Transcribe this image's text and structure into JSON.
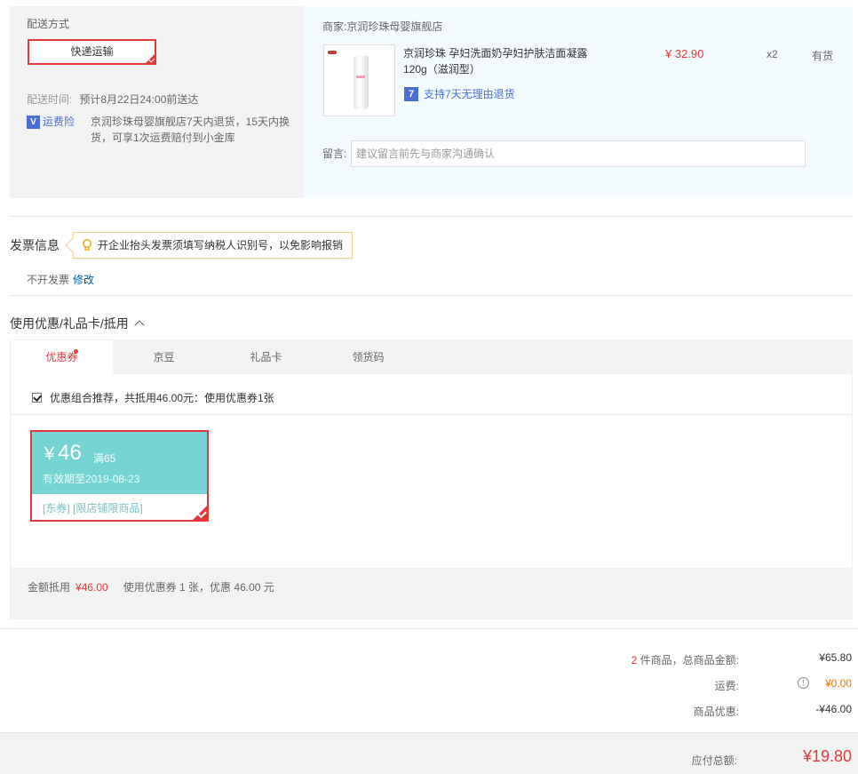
{
  "shipping": {
    "title": "配送方式",
    "option": "快递运输",
    "time_label": "配送时间:",
    "time_value": "预计8月22日24:00前送达",
    "insure_icon": "shield-v-icon",
    "insure_link": "运费险",
    "insure_text": "京润珍珠母婴旗舰店7天内退货，15天内换货，可享1次运费赔付到小金库"
  },
  "merchant": {
    "label": "商家:",
    "name": "京润珍珠母婴旗舰店",
    "product_name": "京润珍珠 孕妇洗面奶孕妇护肤洁面凝露120g（滋润型）",
    "return_icon_char": "7",
    "return_text": "支持7天无理由退货",
    "price": "¥ 32.90",
    "qty": "x2",
    "stock": "有货",
    "remark_label": "留言:",
    "remark_placeholder": "建议留言前先与商家沟通确认"
  },
  "invoice": {
    "title": "发票信息",
    "tip": "开企业抬头发票须填写纳税人识别号，以免影响报销",
    "status": "不开发票",
    "edit": "修改"
  },
  "coupons": {
    "title": "使用优惠/礼品卡/抵用",
    "tabs": [
      "优惠券",
      "京豆",
      "礼品卡",
      "领货码"
    ],
    "combo_text": "优惠组合推荐，共抵用46.00元：使用优惠券1张",
    "card": {
      "yen": "¥",
      "amount": "46",
      "condition": "满65",
      "expiry": "有效期至2019-08-23",
      "tags": "[东券] [限店铺限商品]"
    },
    "footer_label": "金额抵用",
    "footer_amount": "¥46.00",
    "footer_used": "使用优惠券 1 张，优惠 46.00 元"
  },
  "summary": {
    "count": "2",
    "goods_label": " 件商品，总商品金额:",
    "goods_value": "¥65.80",
    "freight_label": "运费:",
    "freight_value": "¥0.00",
    "discount_label": "商品优惠:",
    "discount_value": "-¥46.00",
    "pay_label": "应付总额:",
    "pay_value": "¥19.80"
  },
  "colors": {
    "accent": "#e4393c",
    "coupon": "#76d4d4",
    "link": "#005ea7"
  }
}
